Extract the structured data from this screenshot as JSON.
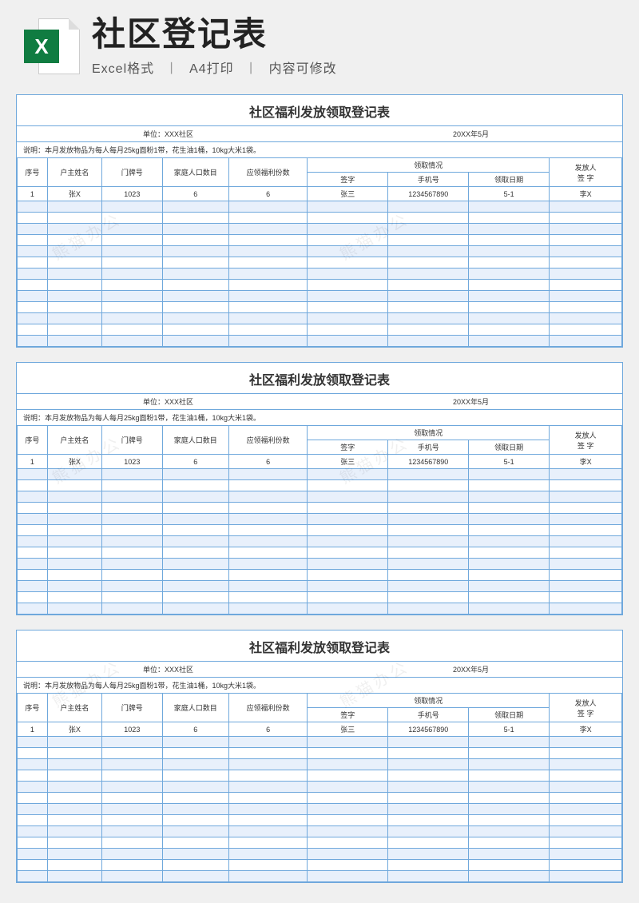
{
  "header": {
    "icon_letter": "X",
    "title": "社区登记表",
    "sub1": "Excel格式",
    "sub2": "A4打印",
    "sub3": "内容可修改"
  },
  "sheet": {
    "title": "社区福利发放领取登记表",
    "unit_label": "单位：XXX社区",
    "date_label": "20XX年5月",
    "note": "说明：本月发放物品为每人每月25kg面粉1带，花生油1桶，10kg大米1袋。",
    "cols": {
      "seq": "序号",
      "owner": "户主姓名",
      "door": "门牌号",
      "pop": "家庭人口数目",
      "qty": "应领福利份数",
      "receive_group": "领取情况",
      "sign": "签字",
      "phone": "手机号",
      "rdate": "领取日期",
      "issuer": "发放人\n签 字"
    },
    "row": {
      "seq": "1",
      "owner": "张X",
      "door": "1023",
      "pop": "6",
      "qty": "6",
      "sign": "张三",
      "phone": "1234567890",
      "rdate": "5-1",
      "issuer": "李X"
    },
    "empty_rows": 13
  },
  "watermark": "熊猫办公"
}
